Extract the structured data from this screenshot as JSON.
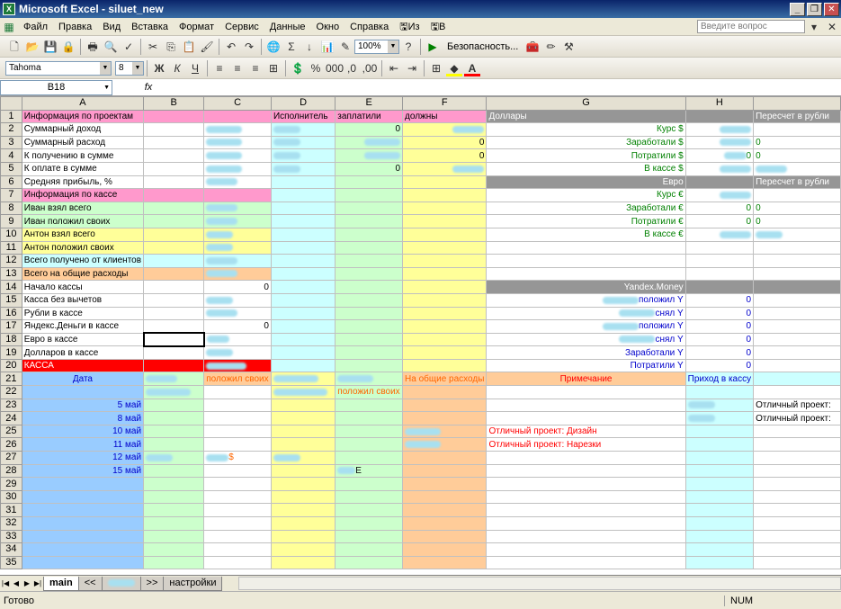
{
  "window": {
    "title": "Microsoft Excel - siluet_new",
    "app_icon": "X"
  },
  "menu": {
    "items": [
      "Файл",
      "Правка",
      "Вид",
      "Вставка",
      "Формат",
      "Сервис",
      "Данные",
      "Окно",
      "Справка",
      "Из",
      "В"
    ],
    "ask_placeholder": "Введите вопрос"
  },
  "toolbar1": {
    "zoom": "100%",
    "security": "Безопасность..."
  },
  "toolbar2": {
    "font": "Tahoma",
    "size": "8"
  },
  "formula_bar": {
    "name_box": "B18",
    "fx": "fx"
  },
  "columns": [
    "A",
    "B",
    "C",
    "D",
    "E",
    "F",
    "G",
    "H"
  ],
  "cells": {
    "A1": "Информация по проектам",
    "D1": "Исполнитель",
    "E1": "заплатили",
    "F1": "должны",
    "G1": "Доллары",
    "I1": "Пересчет в рубли",
    "A2": "Суммарный доход",
    "E2": "0",
    "G2": "Курс $",
    "A3": "Суммарный расход",
    "F3": "0",
    "G3": "Заработали $",
    "I3": "0",
    "A4": "К получению в сумме",
    "F4": "0",
    "G4": "Потратили $",
    "H4": "0",
    "I4": "0",
    "A5": "К оплате в сумме",
    "E5": "0",
    "G5": "В кассе $",
    "A6": "Средняя прибыль, %",
    "G6": "Евро",
    "I6": "Пересчет в рубли",
    "A7": "Информация по кассе",
    "G7": "Курс €",
    "A8": "Иван взял всего",
    "G8": "Заработали €",
    "H8": "0",
    "I8": "0",
    "A9": "Иван положил своих",
    "G9": "Потратили €",
    "H9": "0",
    "I9": "0",
    "A10": "Антон взял всего",
    "G10": "В кассе €",
    "A11": "Антон положил своих",
    "A12": "Всего получено от клиентов",
    "A13": "Всего на общие расходы",
    "A14": "Начало кассы",
    "C14": "0",
    "G14": "Yandex.Money",
    "A15": "Касса без вычетов",
    "G15": "положил Y",
    "H15": "0",
    "A16": "Рубли в кассе",
    "G16": "снял Y",
    "H16": "0",
    "A17": "Яндекс.Деньги в кассе",
    "C17": "0",
    "G17": "положил Y",
    "H17": "0",
    "A18": "Евро в кассе",
    "G18": "снял Y",
    "H18": "0",
    "A19": "Долларов в кассе",
    "G19": "Заработали Y",
    "H19": "0",
    "A20": "КАССА",
    "G20": "Потратили Y",
    "H20": "0",
    "A21": "Дата",
    "C21": "положил своих",
    "E22": "положил своих",
    "F21": "На общие расходы",
    "G21": "Примечание",
    "H21": "Приход в кассу",
    "I23": "Отличный проект:",
    "I24": "Отличный проект:",
    "G25": "Отличный проект: Дизайн",
    "G26": "Отличный проект: Нарезки",
    "C27": "$",
    "E28": "E"
  },
  "dates": {
    "23": "5 май",
    "24": "8 май",
    "25": "10 май",
    "26": "11 май",
    "27": "12 май",
    "28": "15 май"
  },
  "sheet_tabs": [
    "main",
    "<<",
    "",
    ">>",
    "настройки"
  ],
  "status": {
    "left": "Готово",
    "right": "NUM"
  }
}
